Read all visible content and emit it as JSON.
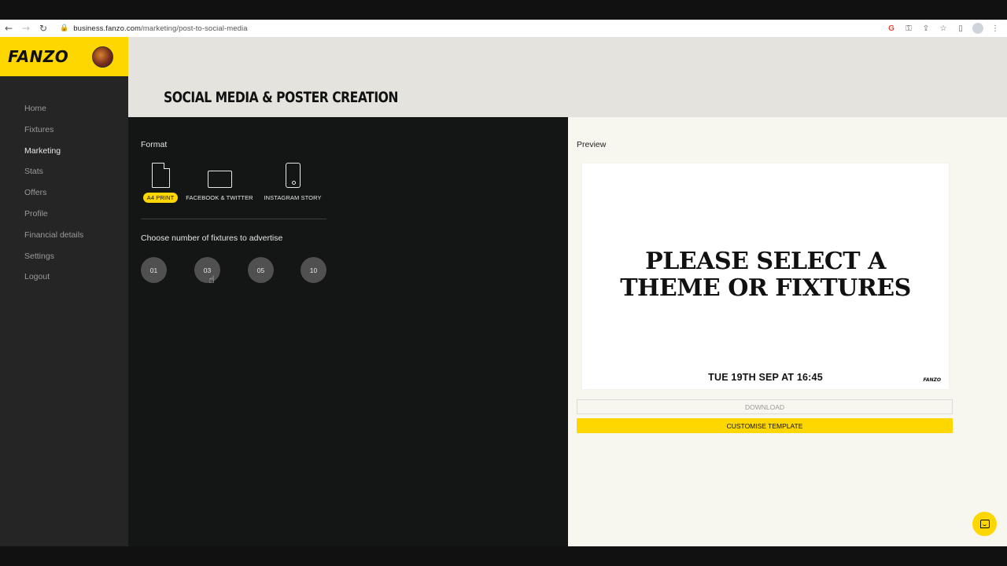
{
  "browser": {
    "url_host": "business.fanzo.com",
    "url_path": "/marketing/post-to-social-media",
    "icons": {
      "back": "←",
      "forward": "→",
      "reload": "↻",
      "lock": "🔒",
      "google": "G",
      "key": "⚿",
      "share": "⇪",
      "star": "☆",
      "sidepanel": "▯",
      "menu": "⋮"
    }
  },
  "sidebar": {
    "logo": "FANZO",
    "items": [
      {
        "label": "Home"
      },
      {
        "label": "Fixtures"
      },
      {
        "label": "Marketing"
      },
      {
        "label": "Stats"
      },
      {
        "label": "Offers"
      },
      {
        "label": "Profile"
      },
      {
        "label": "Financial details"
      },
      {
        "label": "Settings"
      },
      {
        "label": "Logout"
      }
    ],
    "active_item": "Marketing"
  },
  "header": {
    "title": "SOCIAL MEDIA & POSTER CREATION"
  },
  "editor": {
    "format_label": "Format",
    "formats": [
      {
        "label": "A4 PRINT",
        "icon": "document-icon",
        "selected": true
      },
      {
        "label": "FACEBOOK & TWITTER",
        "icon": "landscape-icon",
        "selected": false
      },
      {
        "label": "INSTAGRAM STORY",
        "icon": "phone-icon",
        "selected": false
      }
    ],
    "fixtures_label": "Choose number of fixtures to advertise",
    "fixture_options": [
      "01",
      "03",
      "05",
      "10"
    ],
    "cursor_glyph": "☝"
  },
  "preview": {
    "label": "Preview",
    "message_line1": "PLEASE SELECT A",
    "message_line2": "THEME OR FIXTURES",
    "date": "TUE 19TH SEP AT 16:45",
    "logo": "FANZO",
    "download_label": "DOWNLOAD",
    "customise_label": "CUSTOMISE TEMPLATE"
  },
  "colors": {
    "accent": "#fed700",
    "sidebar_bg": "#252525",
    "panel_bg": "#141615",
    "preview_bg": "#f8f7ef",
    "header_bg": "#e4e3dd"
  }
}
